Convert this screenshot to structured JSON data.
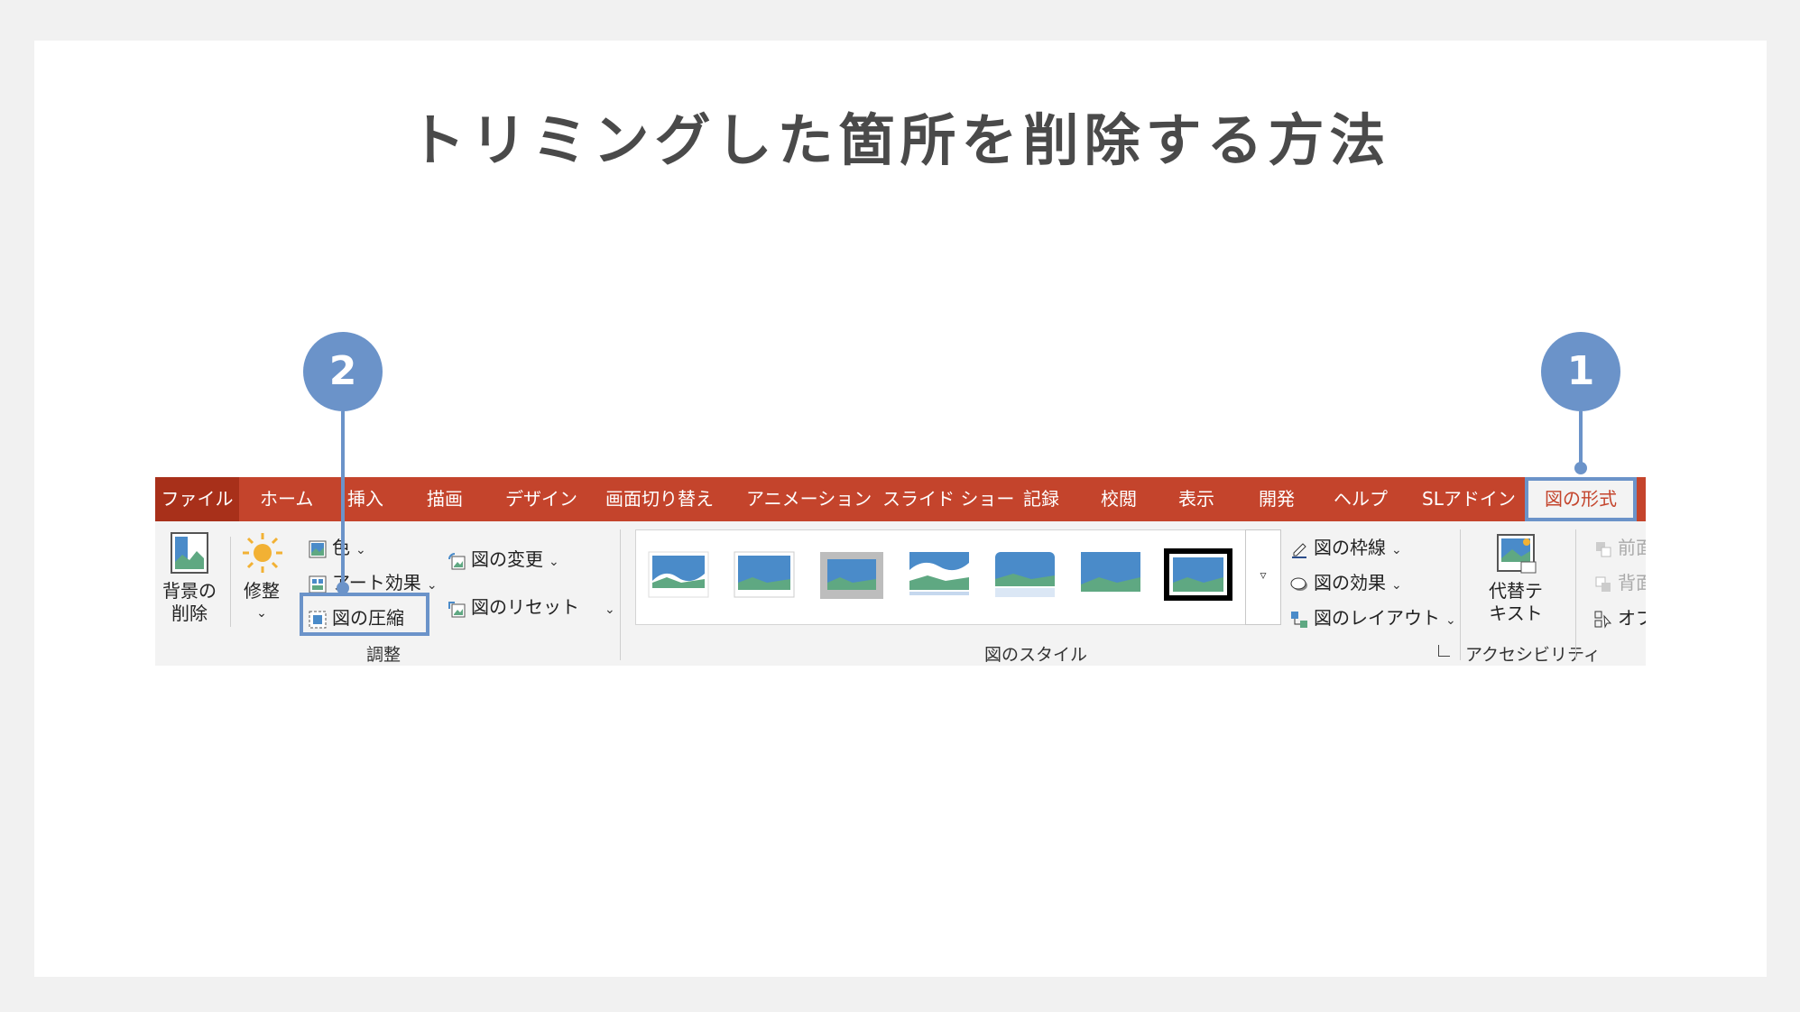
{
  "slide": {
    "title": "トリミングした箇所を削除する方法"
  },
  "ribbon": {
    "tabs": {
      "file": "ファイル",
      "home": "ホーム",
      "insert": "挿入",
      "draw": "描画",
      "design": "デザイン",
      "transitions": "画面切り替え",
      "animations": "アニメーション",
      "slideshow": "スライド ショー",
      "record": "記録",
      "review": "校閲",
      "view": "表示",
      "developer": "開発",
      "help": "ヘルプ",
      "sl_addin": "SLアドイン",
      "picture_format": "図の形式"
    },
    "adjust": {
      "remove_background": [
        "背景の",
        "削除"
      ],
      "corrections": "修整",
      "color": "色",
      "artistic_effects": "アート効果",
      "compress": "図の圧縮",
      "change_picture": "図の変更",
      "reset_picture": "図のリセット",
      "group_label": "調整"
    },
    "styles": {
      "border": "図の枠線",
      "effects": "図の効果",
      "layout": "図のレイアウト",
      "group_label": "図のスタイル",
      "more_glyph": "▿"
    },
    "accessibility": {
      "alt_text": [
        "代替テ",
        "キスト"
      ],
      "group_label": "アクセシビリティ"
    },
    "arrange": {
      "bring_forward": "前面",
      "send_backward": "背面",
      "selection_pane": "オブ"
    }
  },
  "callouts": {
    "one": "1",
    "two": "2"
  },
  "colors": {
    "tab_bar": "#c4442c",
    "file_tab": "#a8301a",
    "callout": "#6b93c9",
    "ribbon_bg": "#f3f3f3"
  }
}
